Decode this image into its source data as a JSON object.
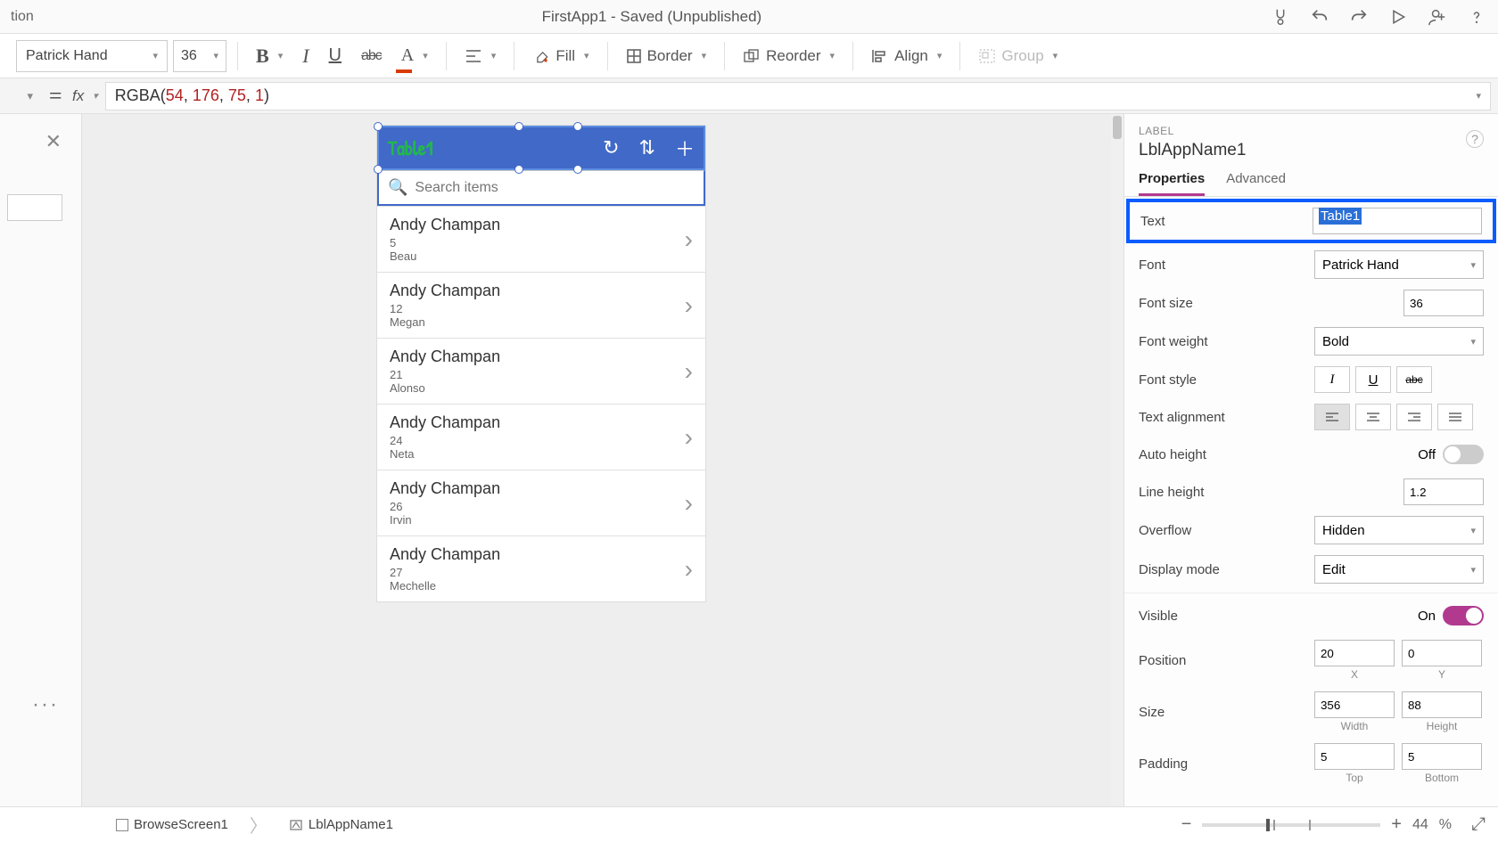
{
  "titlebar": {
    "left_fragment": "tion",
    "title": "FirstApp1 - Saved (Unpublished)"
  },
  "ribbon": {
    "font": "Patrick Hand",
    "size": "36",
    "fill": "Fill",
    "border": "Border",
    "reorder": "Reorder",
    "align": "Align",
    "group": "Group"
  },
  "formula": {
    "fx": "fx",
    "fn": "RGBA",
    "args": [
      "54",
      "176",
      "75",
      "1"
    ]
  },
  "phone": {
    "title": "Table1",
    "search_placeholder": "Search items",
    "items": [
      {
        "name": "Andy Champan",
        "line1": "5",
        "line2": "Beau"
      },
      {
        "name": "Andy Champan",
        "line1": "12",
        "line2": "Megan"
      },
      {
        "name": "Andy Champan",
        "line1": "21",
        "line2": "Alonso"
      },
      {
        "name": "Andy Champan",
        "line1": "24",
        "line2": "Neta"
      },
      {
        "name": "Andy Champan",
        "line1": "26",
        "line2": "Irvin"
      },
      {
        "name": "Andy Champan",
        "line1": "27",
        "line2": "Mechelle"
      }
    ]
  },
  "props": {
    "label": "LABEL",
    "name": "LblAppName1",
    "tabs": {
      "properties": "Properties",
      "advanced": "Advanced"
    },
    "text": {
      "label": "Text",
      "value": "Table1"
    },
    "font": {
      "label": "Font",
      "value": "Patrick Hand"
    },
    "font_size": {
      "label": "Font size",
      "value": "36"
    },
    "font_weight": {
      "label": "Font weight",
      "value": "Bold"
    },
    "font_style": {
      "label": "Font style"
    },
    "text_alignment": {
      "label": "Text alignment"
    },
    "auto_height": {
      "label": "Auto height",
      "state": "Off"
    },
    "line_height": {
      "label": "Line height",
      "value": "1.2"
    },
    "overflow": {
      "label": "Overflow",
      "value": "Hidden"
    },
    "display_mode": {
      "label": "Display mode",
      "value": "Edit"
    },
    "visible": {
      "label": "Visible",
      "state": "On"
    },
    "position": {
      "label": "Position",
      "x": "20",
      "y": "0",
      "xl": "X",
      "yl": "Y"
    },
    "size": {
      "label": "Size",
      "w": "356",
      "h": "88",
      "wl": "Width",
      "hl": "Height"
    },
    "padding": {
      "label": "Padding",
      "t": "5",
      "b": "5",
      "tl": "Top",
      "bl": "Bottom"
    }
  },
  "status": {
    "screen": "BrowseScreen1",
    "control": "LblAppName1",
    "zoom": "44",
    "pct": "%"
  }
}
